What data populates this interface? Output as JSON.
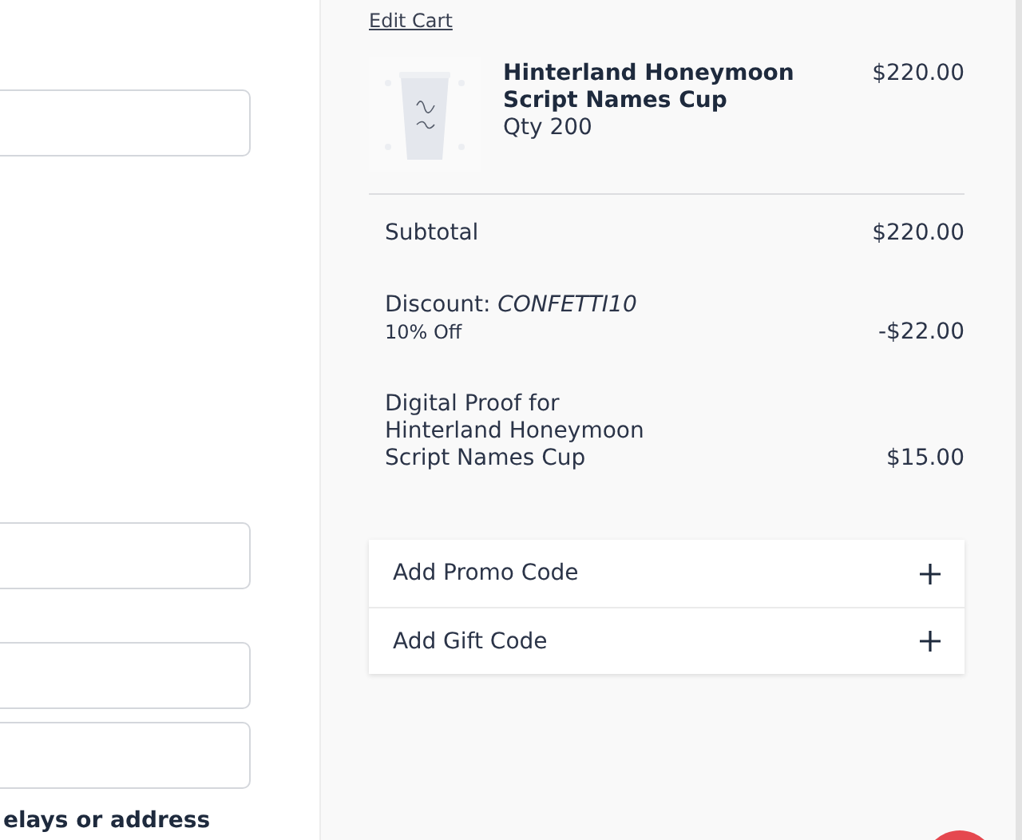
{
  "form": {
    "fields": [
      {
        "kind": "input"
      },
      {
        "kind": "input"
      },
      {
        "kind": "input"
      },
      {
        "kind": "input"
      }
    ],
    "note": "elays or address"
  },
  "summary": {
    "edit_link": "Edit Cart",
    "items": [
      {
        "name": "Hinterland Honeymoon Script Names Cup",
        "quantity": "Qty 200",
        "price": "$220.00"
      }
    ],
    "lines": [
      {
        "label": "Subtotal",
        "amount": "$220.00"
      },
      {
        "label": "Discount:",
        "code": "CONFETTI10",
        "sublabel": "10% Off",
        "amount": "-$22.00"
      },
      {
        "label": "Digital Proof for Hinterland Honeymoon Script Names Cup",
        "amount": "$15.00"
      }
    ],
    "codes": [
      {
        "label": "Add Promo Code",
        "expanded": false
      },
      {
        "label": "Add Gift Code",
        "expanded": false
      }
    ]
  }
}
